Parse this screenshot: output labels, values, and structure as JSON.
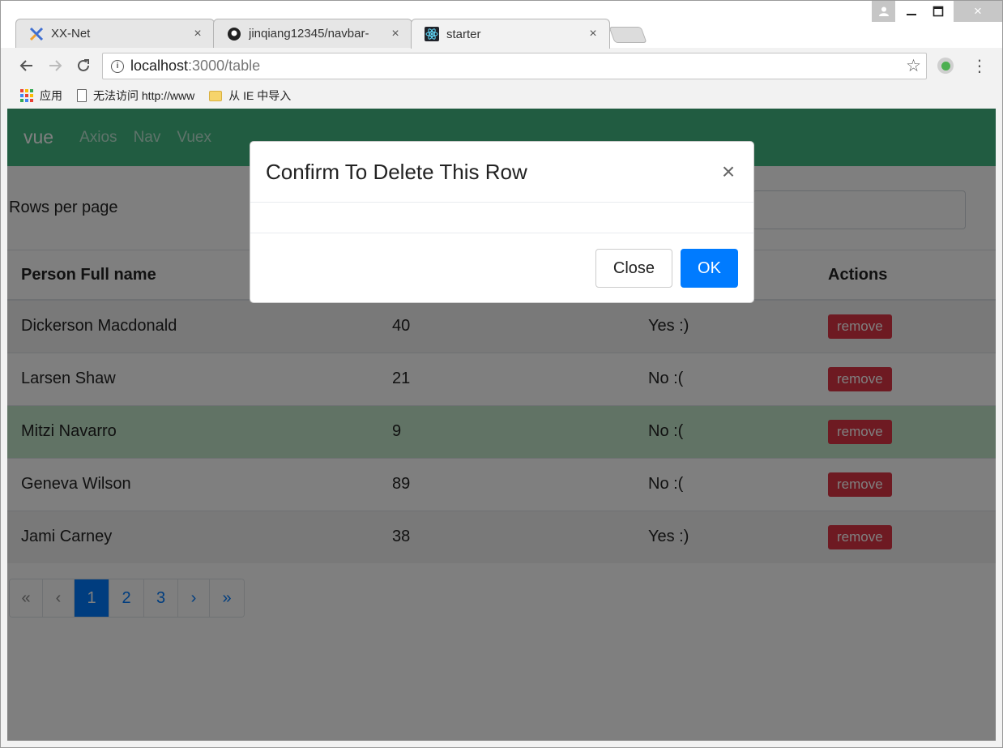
{
  "browser": {
    "tabs": [
      {
        "title": "XX-Net",
        "icon": "xx-net-icon"
      },
      {
        "title": "jinqiang12345/navbar-",
        "icon": "github-icon"
      },
      {
        "title": "starter",
        "icon": "react-icon"
      }
    ],
    "close_glyph": "×",
    "url_host": "localhost",
    "url_path": ":3000/table",
    "bookmarks": [
      {
        "label": "应用",
        "icon": "apps-icon"
      },
      {
        "label": "无法访问 http://www",
        "icon": "page-icon"
      },
      {
        "label": "从 IE 中导入",
        "icon": "folder-icon"
      }
    ]
  },
  "app": {
    "brand": "vue",
    "nav_links": [
      "Axios",
      "Nav",
      "Vuex"
    ],
    "rows_per_page_label": "Rows per page",
    "table": {
      "headers": [
        "Person Full name",
        "",
        "",
        "Actions"
      ],
      "rows": [
        {
          "name": "Dickerson Macdonald",
          "age": "40",
          "active": "Yes :)",
          "action": "remove",
          "variant": "odd"
        },
        {
          "name": "Larsen Shaw",
          "age": "21",
          "active": "No :(",
          "action": "remove",
          "variant": "even"
        },
        {
          "name": "Mitzi Navarro",
          "age": "9",
          "active": "No :(",
          "action": "remove",
          "variant": "success"
        },
        {
          "name": "Geneva Wilson",
          "age": "89",
          "active": "No :(",
          "action": "remove",
          "variant": "even"
        },
        {
          "name": "Jami Carney",
          "age": "38",
          "active": "Yes :)",
          "action": "remove",
          "variant": "odd"
        }
      ]
    },
    "pagination": {
      "first": "«",
      "prev": "‹",
      "pages": [
        "1",
        "2",
        "3"
      ],
      "current_page": "1",
      "next": "›",
      "last": "»"
    }
  },
  "modal": {
    "title": "Confirm To Delete This Row",
    "close_glyph": "×",
    "cancel_label": "Close",
    "ok_label": "OK"
  },
  "colors": {
    "navbar": "#42b983",
    "primary": "#007bff",
    "danger": "#dc3545",
    "success_row": "#c3e6cb"
  }
}
